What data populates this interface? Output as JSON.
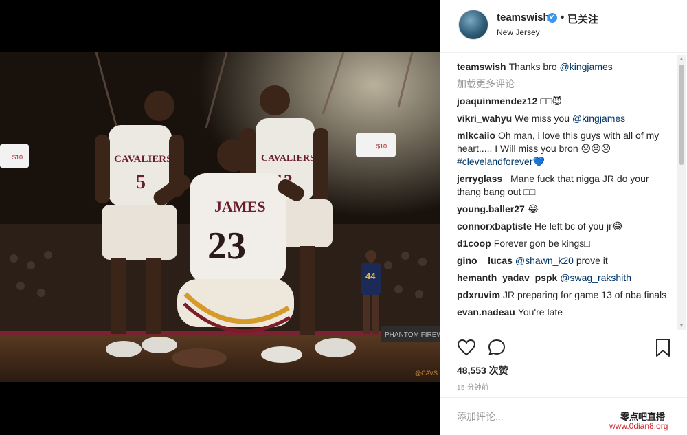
{
  "header": {
    "username": "teamswish",
    "verified_mark": "✔",
    "separator": "•",
    "follow_label": "已关注",
    "location": "New Jersey"
  },
  "photo": {
    "jersey_left_name": "CAVALIERS",
    "jersey_left_number": "5",
    "jersey_center_name": "JAMES",
    "jersey_center_number": "23",
    "jersey_right_name": "CAVALIERS",
    "jersey_right_number": "13",
    "opponent_number": "44",
    "arena_sign": "PHANTOM FIREWORKS",
    "corner_tag": "@CAVS",
    "ad_price": "$10"
  },
  "caption": {
    "user": "teamswish",
    "text": "Thanks bro ",
    "mention": "@kingjames"
  },
  "load_more": "加载更多评论",
  "comments": [
    {
      "user": "joaquinmendez12",
      "text": "□□😈",
      "mention": "",
      "tag": "",
      "tail": ""
    },
    {
      "user": "vikri_wahyu",
      "text": "We miss you ",
      "mention": "@kingjames",
      "tag": "",
      "tail": ""
    },
    {
      "user": "mlkcaiio",
      "text": "Oh man, i love this guys with all of my heart..... I Will miss you bron 😞😞😞 ",
      "mention": "",
      "tag": "#clevelandforever",
      "tail": "💙"
    },
    {
      "user": "jerryglass_",
      "text": "Mane fuck that nigga JR do your thang bang out □□",
      "mention": "",
      "tag": "",
      "tail": ""
    },
    {
      "user": "young.baller27",
      "text": "😂",
      "mention": "",
      "tag": "",
      "tail": ""
    },
    {
      "user": "connorxbaptiste",
      "text": "He left bc of you jr😂",
      "mention": "",
      "tag": "",
      "tail": ""
    },
    {
      "user": "d1coop",
      "text": "Forever gon be kings□",
      "mention": "",
      "tag": "",
      "tail": ""
    },
    {
      "user": "gino__lucas",
      "text": "",
      "mention": "@shawn_k20",
      "tag": "",
      "tail": " prove it"
    },
    {
      "user": "hemanth_yadav_pspk",
      "text": "",
      "mention": "@swag_rakshith",
      "tag": "",
      "tail": ""
    },
    {
      "user": "pdxruvim",
      "text": "JR preparing for game 13 of nba finals",
      "mention": "",
      "tag": "",
      "tail": ""
    },
    {
      "user": "evan.nadeau",
      "text": "You're late",
      "mention": "",
      "tag": "",
      "tail": ""
    }
  ],
  "likes": {
    "count": "48,553",
    "label": " 次赞"
  },
  "timestamp": "15 分钟前",
  "add_comment": {
    "placeholder": "添加评论..."
  },
  "watermark": {
    "name": "零点吧直播",
    "url": "www.0dian8.org"
  },
  "icons": [
    "heart-icon",
    "comment-icon",
    "bookmark-icon",
    "verified-badge-icon"
  ]
}
